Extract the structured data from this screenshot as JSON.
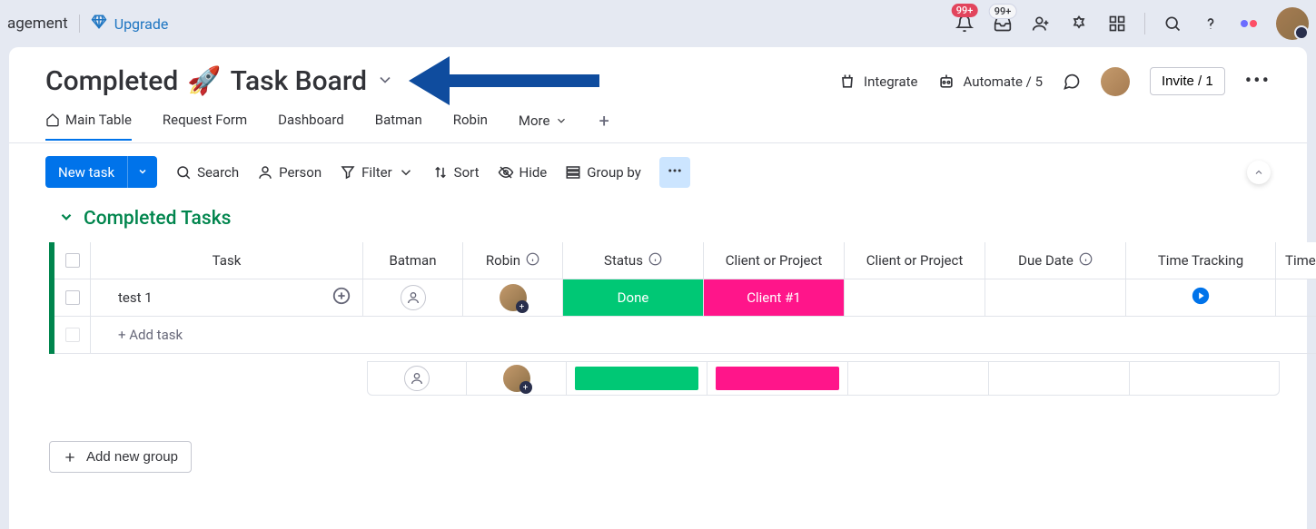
{
  "topbar": {
    "partial_text": "agement",
    "upgrade": "Upgrade",
    "notifications_badge": "99+",
    "inbox_badge": "99+"
  },
  "board": {
    "title_prefix": "Completed",
    "title_emoji": "🚀",
    "title_suffix": "Task Board"
  },
  "header_actions": {
    "integrate": "Integrate",
    "automate": "Automate / 5",
    "invite": "Invite / 1"
  },
  "tabs": [
    {
      "label": "Main Table",
      "active": true,
      "icon": "home"
    },
    {
      "label": "Request Form"
    },
    {
      "label": "Dashboard"
    },
    {
      "label": "Batman"
    },
    {
      "label": "Robin"
    }
  ],
  "tabs_more": "More",
  "toolbar": {
    "new_task": "New task",
    "search": "Search",
    "person": "Person",
    "filter": "Filter",
    "sort": "Sort",
    "hide": "Hide",
    "group_by": "Group by"
  },
  "group": {
    "title": "Completed Tasks"
  },
  "columns": {
    "task": "Task",
    "batman": "Batman",
    "robin": "Robin",
    "status": "Status",
    "client1": "Client or Project",
    "client2": "Client or Project",
    "due": "Due Date",
    "tracking": "Time Tracking",
    "time2": "Time"
  },
  "rows": [
    {
      "task": "test 1",
      "status": "Done",
      "client": "Client #1"
    }
  ],
  "add_task": "+ Add task",
  "add_group": "Add new group",
  "colors": {
    "done": "#00c875",
    "client": "#ff158a",
    "primary": "#0073ea",
    "group": "#00854d"
  }
}
